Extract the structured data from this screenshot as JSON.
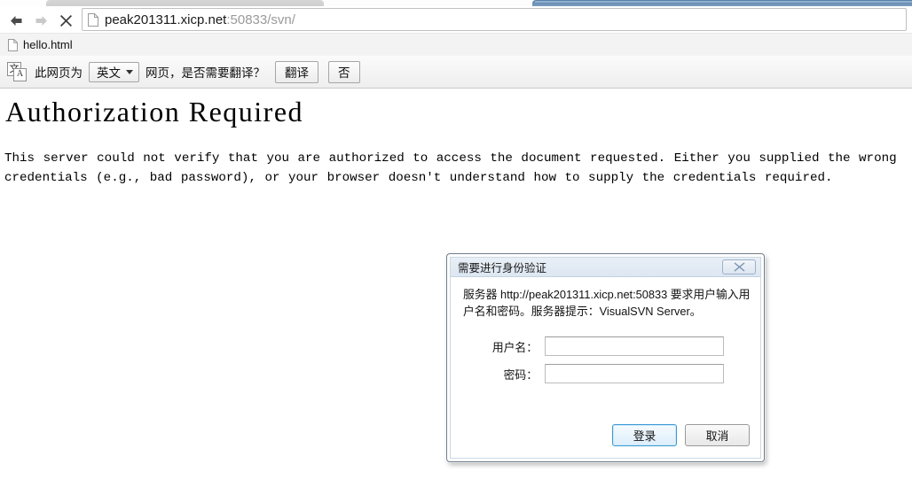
{
  "browser": {
    "nav": {
      "back_title": "Back",
      "forward_title": "Forward",
      "stop_title": "Stop"
    },
    "omnibox": {
      "host": "peak201311.xicp.net",
      "rest": ":50833/svn/",
      "full_url": "peak201311.xicp.net:50833/svn/",
      "page_icon": "document-icon"
    },
    "bookmarks": [
      {
        "label": "hello.html",
        "icon": "document-icon"
      }
    ]
  },
  "translate_bar": {
    "icon": "translate-icon",
    "icon_glyph_cn": "文",
    "icon_glyph_en": "A",
    "prefix_text": "此网页为",
    "language_selected": "英文",
    "suffix_text": "网页，是否需要翻译？",
    "translate_button": "翻译",
    "no_button": "否"
  },
  "page": {
    "heading": "Authorization Required",
    "body": "This server could not verify that you are authorized to access the document requested.  Either you supplied the wrong credentials (e.g., bad password), or your browser doesn't understand how to supply the credentials required."
  },
  "dialog": {
    "title": "需要进行身份验证",
    "close_label": "✕",
    "message": "服务器 http://peak201311.xicp.net:50833 要求用户输入用户名和密码。服务器提示：VisualSVN Server。",
    "username_label": "用户名：",
    "username_value": "",
    "username_placeholder": "",
    "password_label": "密码：",
    "password_value": "",
    "password_placeholder": "",
    "login_button": "登录",
    "cancel_button": "取消",
    "accent_color": "#3c9ad6"
  }
}
